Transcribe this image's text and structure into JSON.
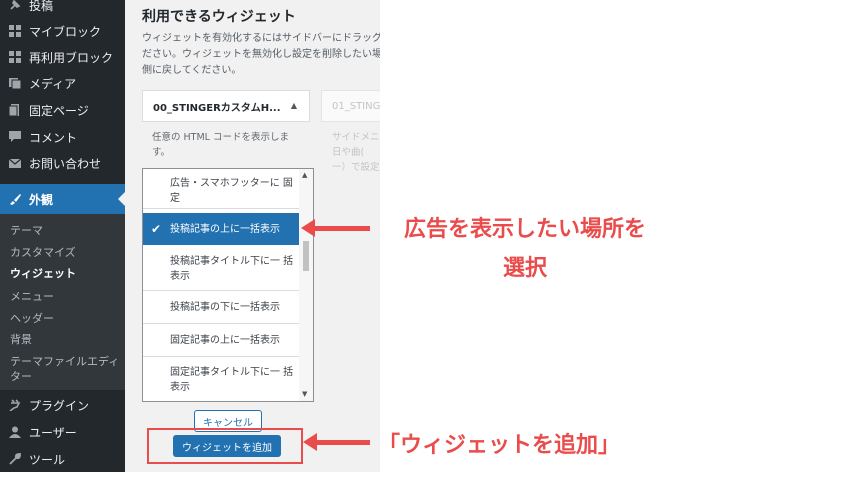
{
  "sidebar": {
    "items": [
      {
        "label": "投稿",
        "icon": "pin-icon"
      },
      {
        "label": "マイブロック",
        "icon": "blocks-icon"
      },
      {
        "label": "再利用ブロック",
        "icon": "blocks-icon"
      },
      {
        "label": "メディア",
        "icon": "media-icon"
      },
      {
        "label": "固定ページ",
        "icon": "page-icon"
      },
      {
        "label": "コメント",
        "icon": "comment-icon"
      },
      {
        "label": "お問い合わせ",
        "icon": "mail-icon"
      },
      {
        "label": "外観",
        "icon": "brush-icon"
      },
      {
        "label": "プラグイン",
        "icon": "plugin-icon"
      },
      {
        "label": "ユーザー",
        "icon": "user-icon"
      },
      {
        "label": "ツール",
        "icon": "wrench-icon"
      }
    ],
    "submenu": [
      "テーマ",
      "カスタマイズ",
      "ウィジェット",
      "メニュー",
      "ヘッダー",
      "背景",
      "テーマファイルエディ",
      "ター"
    ],
    "current_submenu": "ウィジェット"
  },
  "panel": {
    "title": "利用できるウィジェット",
    "description": "ウィジェットを有効化するにはサイドバーにドラッグ\nださい。ウィジェットを無効化し設定を削除したい場\n側に戻してください。",
    "widget": {
      "name": "00_STINGERカスタムH...",
      "description": "任意の HTML コードを表示しま す。"
    },
    "widget2": {
      "name": "01_STINGE",
      "description": "サイドメニ\n日や曲(\n一）で設定"
    },
    "sidebar_options": [
      "広告・スマホフッターに 固定",
      "投稿記事の上に一括表示",
      "投稿記事タイトル下に一 括表示",
      "投稿記事の下に一括表示",
      "固定記事の上に一括表示",
      "固定記事タイトル下に一 括表示"
    ],
    "selected_option": "投稿記事の上に一括表示",
    "cancel_label": "キャンセル",
    "add_label": "ウィジェットを追加"
  },
  "annotations": {
    "select_note_line1": "広告を表示したい場所を",
    "select_note_line2": "選択",
    "add_note": "「ウィジェットを追加」"
  },
  "colors": {
    "sidebar_bg": "#23282d",
    "accent": "#2271b1",
    "annotation": "#ea4b4b"
  }
}
